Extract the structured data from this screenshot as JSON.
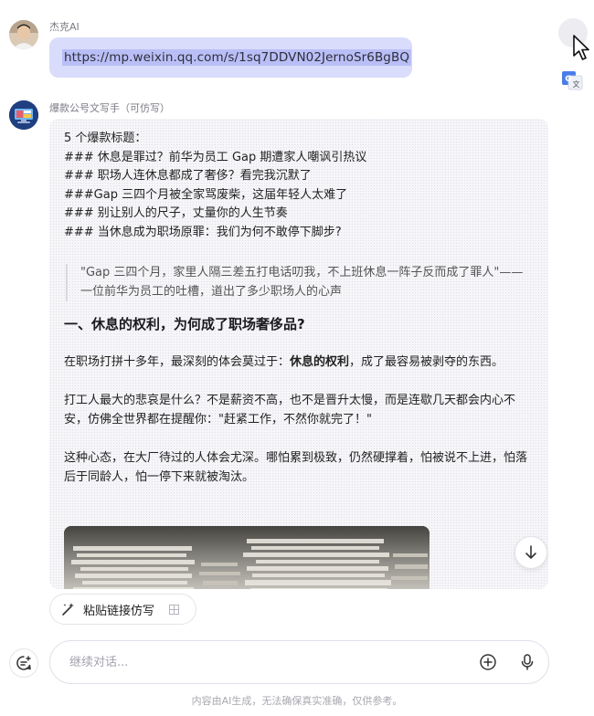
{
  "user_message": {
    "sender": "杰克AI",
    "url": "https://mp.weixin.qq.com/s/1sq7DDVN02JernoSr6BgBQ"
  },
  "bot_message": {
    "sender": "爆款公号文写手（可仿写）",
    "titles": [
      "5 个爆款标题：",
      "### 休息是罪过？前华为员工 Gap 期遭家人嘲讽引热议",
      "### 职场人连休息都成了奢侈？看完我沉默了",
      "###Gap 三四个月被全家骂废柴，这届年轻人太难了",
      "### 别让别人的尺子，丈量你的人生节奏",
      "### 当休息成为职场原罪：我们为何不敢停下脚步?"
    ],
    "quote": "\"Gap 三四个月，家里人隔三差五打电话叨我，不上班休息一阵子反而成了罪人\"—— 一位前华为员工的吐槽，道出了多少职场人的心声",
    "heading": "一、休息的权利，为何成了职场奢侈品?",
    "para1_before": "在职场打拼十多年，最深刻的体会莫过于：",
    "para1_bold": "休息的权利",
    "para1_after": "，成了最容易被剥夺的东西。",
    "para2": "打工人最大的悲哀是什么？不是薪资不高，也不是晋升太慢，而是连歇几天都会内心不安，仿佛全世界都在提醒你：\"赶紧工作，不然你就完了！\"",
    "para3": "这种心态，在大厂待过的人体会尤深。哪怕累到极致，仍然硬撑着，怕被说不上进，怕落后于同龄人，怕一停下来就被淘汰。"
  },
  "actions": {
    "paste_chip_label": "粘贴链接仿写"
  },
  "composer": {
    "placeholder": "继续对话..."
  },
  "footer": {
    "disclaimer": "内容由AI生成，无法确保真实准确，仅供参考。"
  },
  "icons": {
    "cursor": "mouse-pointer-icon",
    "translate": "translate-icon",
    "scroll": "arrow-down-icon",
    "paste": "magic-wand-icon",
    "new_chat": "new-chat-icon",
    "add": "plus-circle-icon",
    "mic": "microphone-icon"
  },
  "colors": {
    "url_bubble": "#d9dcfb",
    "url_highlight": "#b9bff6",
    "content_bg": "#f6f6f9"
  }
}
